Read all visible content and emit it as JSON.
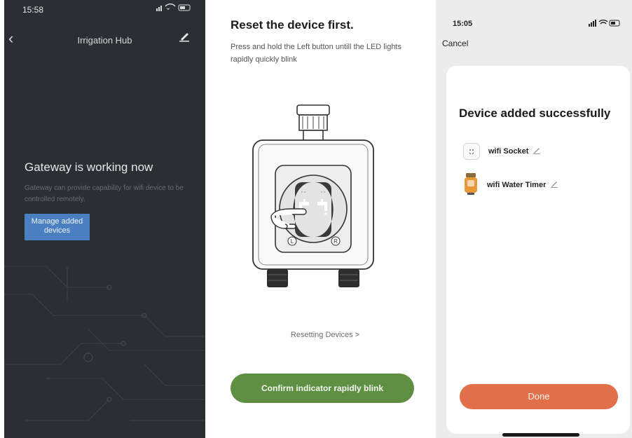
{
  "panel1": {
    "time": "15:58",
    "title": "Irrigation Hub",
    "headline": "Gateway is working now",
    "description": "Gateway can provide capability for wifi device to be controlled remotely.",
    "manage_button": "Manage added devices"
  },
  "panel2": {
    "title": "Reset the device first.",
    "description": "Press and hold the Left button untill the LED lights rapidly quickly blink",
    "resetting_link": "Resetting Devices >",
    "confirm_button": "Confirm indicator rapidly blink",
    "button_labels": [
      "L",
      "R"
    ]
  },
  "panel3": {
    "time": "15:05",
    "cancel": "Cancel",
    "title": "Device added successfully",
    "devices": [
      {
        "name": "wifi Socket",
        "icon": "socket-icon"
      },
      {
        "name": "wifi Water Timer",
        "icon": "water-timer-icon"
      }
    ],
    "done_button": "Done"
  },
  "colors": {
    "dark_bg": "#2b2e33",
    "manage_blue": "#4a7fc1",
    "confirm_green": "#5f8f43",
    "done_orange": "#e2704a"
  }
}
